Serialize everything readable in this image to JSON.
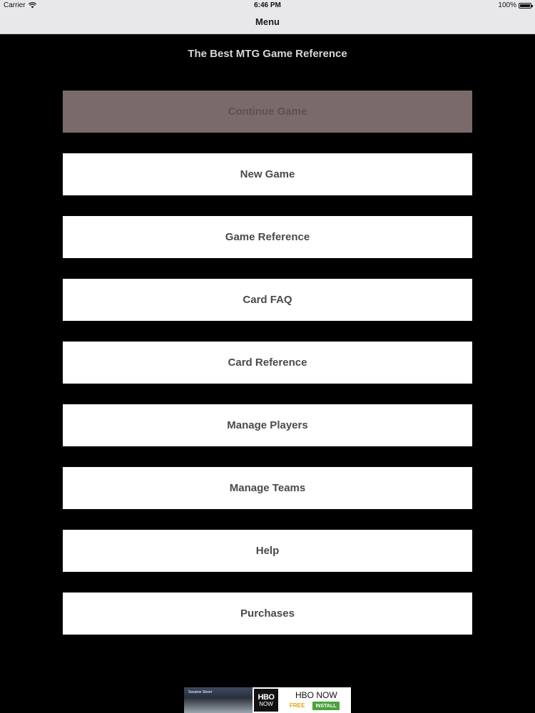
{
  "status_bar": {
    "carrier": "Carrier",
    "time": "6:46 PM",
    "battery": "100%"
  },
  "nav": {
    "title": "Menu"
  },
  "heading": "The Best MTG Game Reference",
  "menu": {
    "items": [
      {
        "label": "Continue Game",
        "enabled": false
      },
      {
        "label": "New Game",
        "enabled": true
      },
      {
        "label": "Game Reference",
        "enabled": true
      },
      {
        "label": "Card FAQ",
        "enabled": true
      },
      {
        "label": "Card Reference",
        "enabled": true
      },
      {
        "label": "Manage Players",
        "enabled": true
      },
      {
        "label": "Manage Teams",
        "enabled": true
      },
      {
        "label": "Help",
        "enabled": true
      },
      {
        "label": "Purchases",
        "enabled": true
      }
    ]
  },
  "ad": {
    "thumb_label": "Sesame Street",
    "logo_top": "HBO",
    "logo_bottom": "NOW",
    "title": "HBO NOW",
    "free_label": "FREE",
    "install_label": "INSTALL"
  },
  "colors": {
    "background": "#000000",
    "nav_bar": "#e8e7ea",
    "button": "#ffffff",
    "button_disabled": "#7a6b6b",
    "button_text": "#4a4a4a",
    "install_green": "#4aa23c",
    "free_yellow": "#e0a800"
  },
  "icons": {
    "wifi": "wifi-icon",
    "battery": "battery-icon"
  }
}
